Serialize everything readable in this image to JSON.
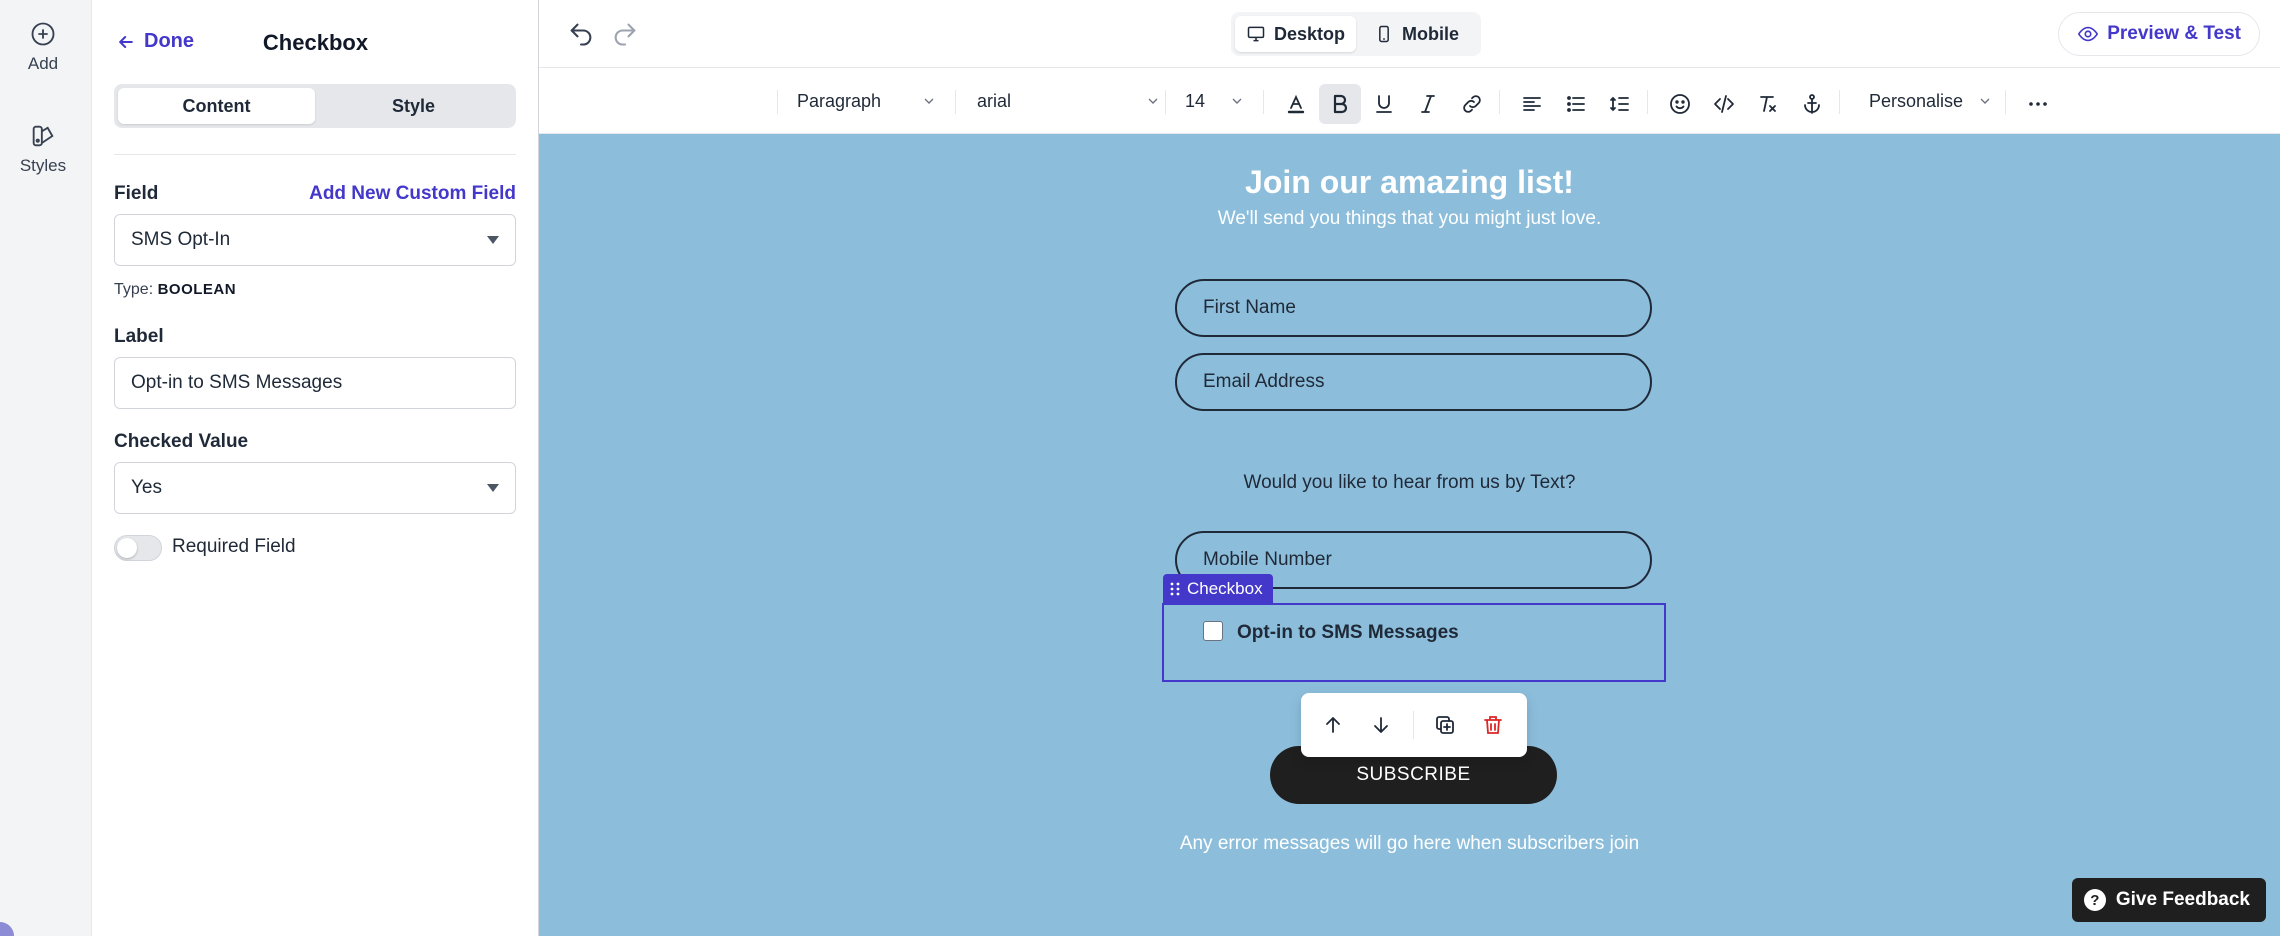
{
  "rail": {
    "add_label": "Add",
    "styles_label": "Styles"
  },
  "panel": {
    "done_label": "Done",
    "title": "Checkbox",
    "tabs": [
      {
        "label": "Content",
        "active": true
      },
      {
        "label": "Style",
        "active": false
      }
    ],
    "field_label": "Field",
    "add_custom_field_label": "Add New Custom Field",
    "field_value": "SMS Opt-In",
    "type_prefix": "Type:",
    "type_value": "BOOLEAN",
    "label_heading": "Label",
    "label_value": "Opt-in to SMS Messages",
    "checked_value_heading": "Checked Value",
    "checked_value": "Yes",
    "required_label": "Required Field",
    "required_on": false
  },
  "topbar": {
    "devices": [
      {
        "label": "Desktop",
        "active": true,
        "icon": "desktop-icon"
      },
      {
        "label": "Mobile",
        "active": false,
        "icon": "mobile-icon"
      }
    ],
    "preview_label": "Preview & Test"
  },
  "toolbar": {
    "block_type": "Paragraph",
    "font": "arial",
    "font_size": "14",
    "personalise_label": "Personalise"
  },
  "form": {
    "title": "Join our amazing list!",
    "subtitle": "We'll send you things that you might just love.",
    "first_name_placeholder": "First Name",
    "email_placeholder": "Email Address",
    "question": "Would you like to hear from us by Text?",
    "mobile_placeholder": "Mobile Number",
    "checkbox_tag": "Checkbox",
    "checkbox_label": "Opt-in to SMS Messages",
    "subscribe_label": "SUBSCRIBE",
    "error_text": "Any error messages will go here when subscribers join"
  },
  "feedback_label": "Give Feedback",
  "colors": {
    "accent": "#4338ca",
    "canvas_bg": "#8cbedc",
    "button_dark": "#1f1f1f",
    "delete_red": "#dc2626"
  }
}
